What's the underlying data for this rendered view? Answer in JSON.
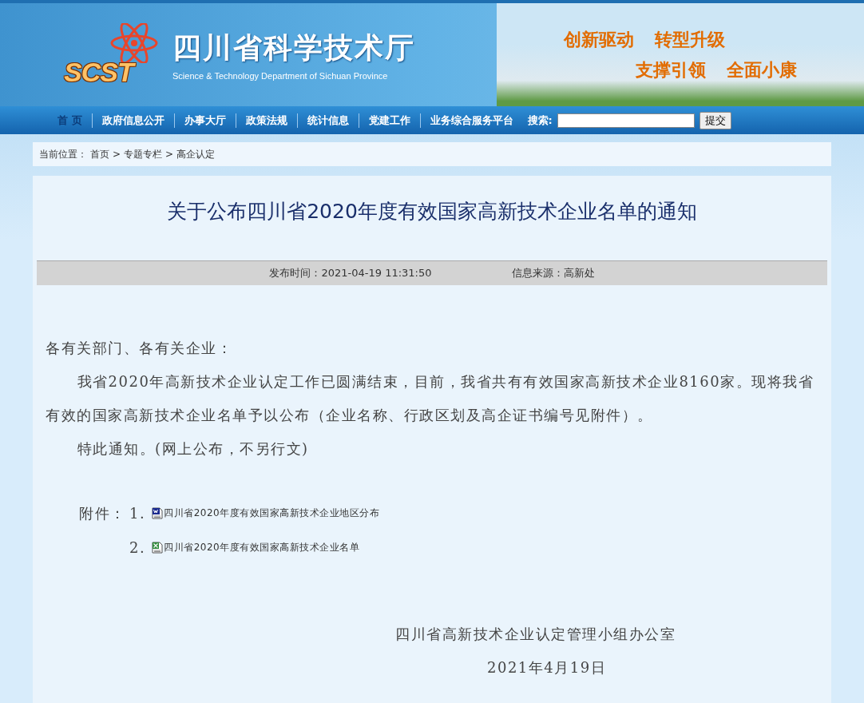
{
  "header": {
    "logo": "SCST",
    "title": "四川省科学技术厅",
    "subtitle": "Science & Technology Department of Sichuan Province",
    "slogans": [
      "创新驱动",
      "转型升级",
      "支撑引领",
      "全面小康"
    ]
  },
  "nav": {
    "items": [
      {
        "label": "首 页",
        "selected": true
      },
      {
        "label": "政府信息公开",
        "selected": false
      },
      {
        "label": "办事大厅",
        "selected": false
      },
      {
        "label": "政策法规",
        "selected": false
      },
      {
        "label": "统计信息",
        "selected": false
      },
      {
        "label": "党建工作",
        "selected": false
      },
      {
        "label": "业务综合服务平台",
        "selected": false
      }
    ],
    "search_label": "搜索:",
    "search_button": "提交"
  },
  "breadcrumb": {
    "label": "当前位置：",
    "items": [
      "首页",
      "专题专栏",
      "高企认定"
    ],
    "separator": ">"
  },
  "article": {
    "title": "关于公布四川省2020年度有效国家高新技术企业名单的通知",
    "publish_time": "发布时间：2021-04-19 11:31:50",
    "source": "信息来源：高新处",
    "salutation": "各有关部门、各有关企业：",
    "paragraphs": [
      "我省2020年高新技术企业认定工作已圆满结束，目前，我省共有有效国家高新技术企业8160家。现将我省有效的国家高新技术企业名单予以公布（企业名称、行政区划及高企证书编号见附件）。",
      "特此通知。(网上公布，不另行文)"
    ],
    "attachments_label": "附件：",
    "attachments": [
      {
        "number": "1.",
        "kind": "word",
        "name": "四川省2020年度有效国家高新技术企业地区分布"
      },
      {
        "number": "2.",
        "kind": "excel",
        "name": "四川省2020年度有效国家高新技术企业名单"
      }
    ],
    "signature": "四川省高新技术企业认定管理小组办公室",
    "date": "2021年4月19日"
  }
}
